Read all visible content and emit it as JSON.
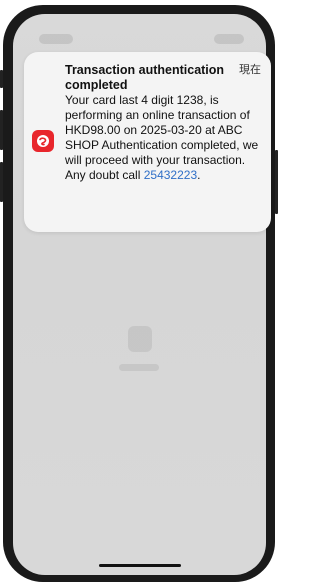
{
  "notification": {
    "title": "Transaction authentication completed",
    "time": "現在",
    "body_text": "Your card last 4 digit 1238, is performing an online transaction of HKD98.00 on 2025-03-20 at ABC SHOP Authentication completed, we will proceed with your transaction. Any doubt call",
    "phone": "25432223",
    "phone_suffix": ".",
    "app_icon": "bank-app-icon",
    "accent_color": "#e8262c",
    "link_color": "#2f6fc7"
  }
}
